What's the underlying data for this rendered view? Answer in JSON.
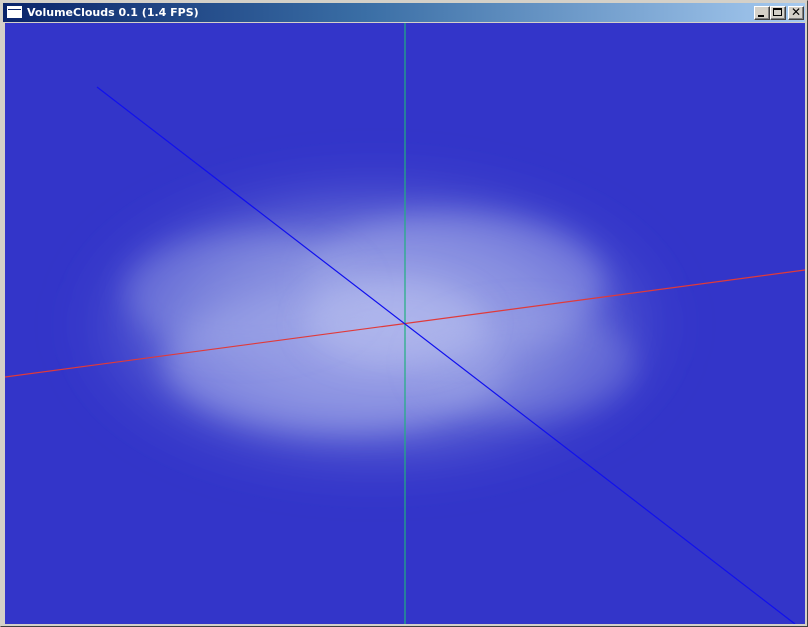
{
  "window": {
    "title": "VolumeClouds 0.1 (1.4 FPS)",
    "icon": "app-window-icon",
    "controls": {
      "minimize_icon": "minimize-icon",
      "maximize_icon": "maximize-icon",
      "close_icon": "close-icon",
      "close_glyph": "✕"
    }
  },
  "scene": {
    "background_color": "#3335c9",
    "cloud_color": "#c8d0f4",
    "axes": [
      {
        "name": "x-axis",
        "color": "#e03a3a"
      },
      {
        "name": "y-axis",
        "color": "#20b080"
      },
      {
        "name": "z-axis",
        "color": "#1010ee"
      }
    ]
  }
}
